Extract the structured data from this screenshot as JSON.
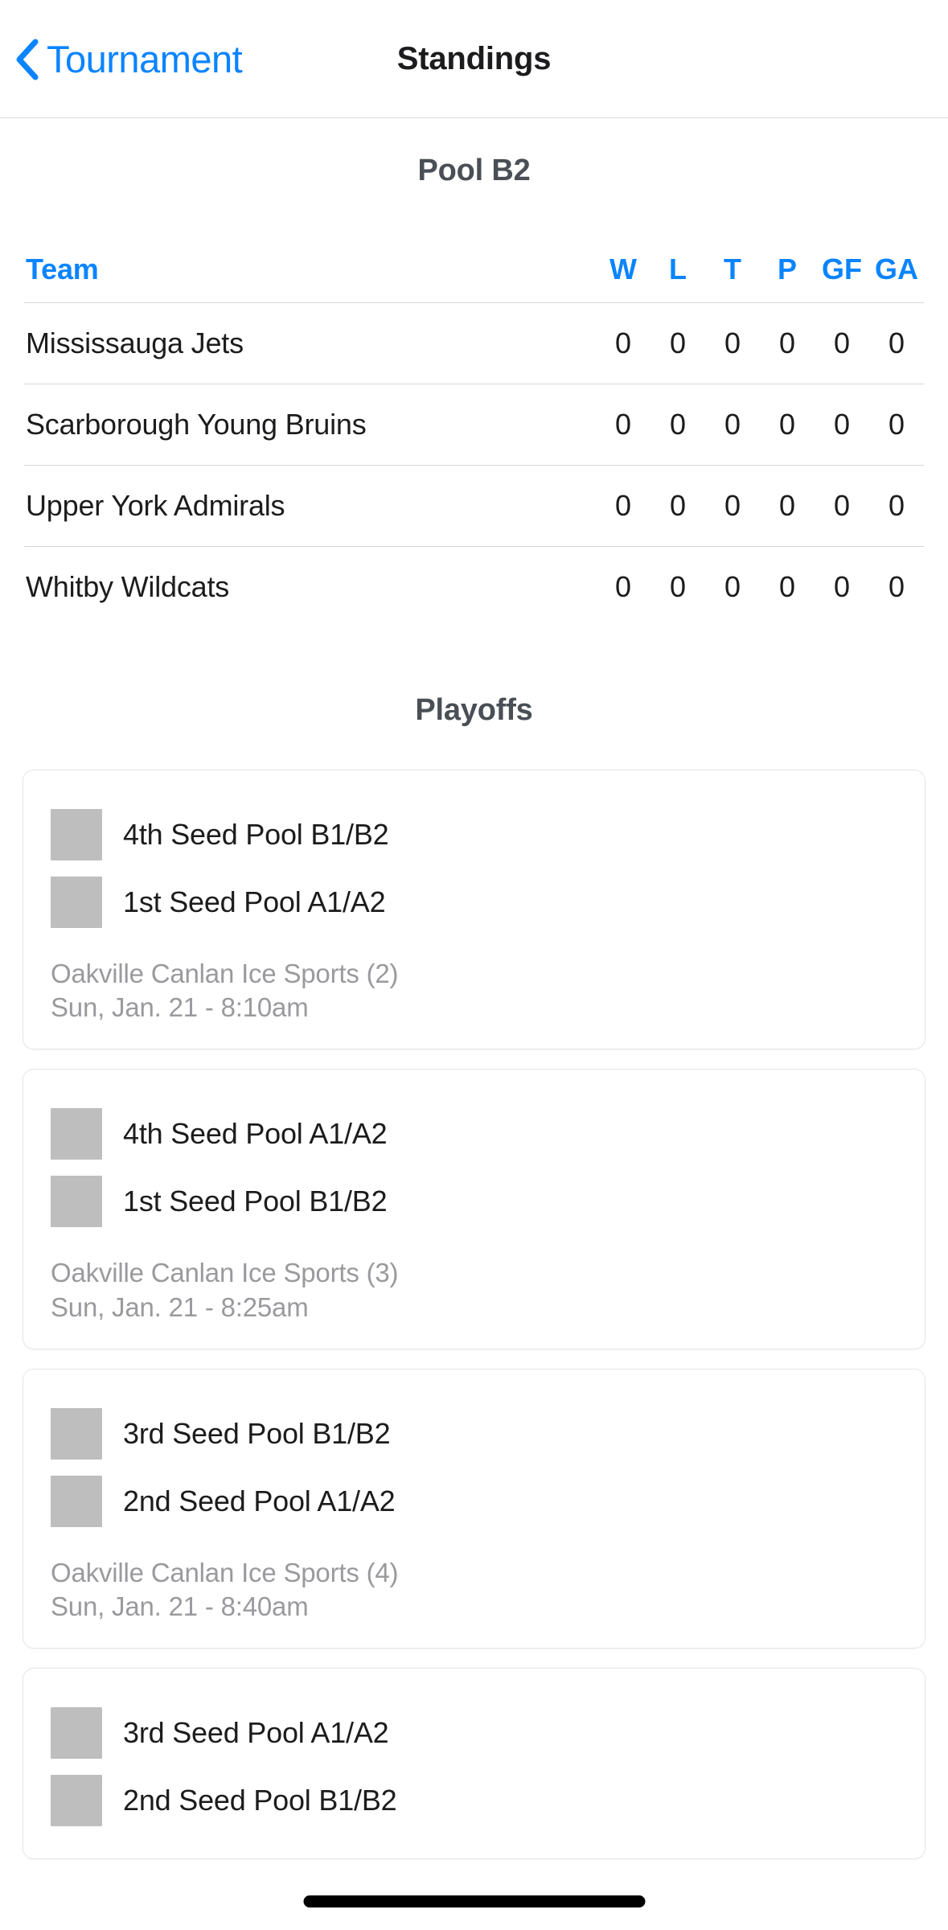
{
  "navbar": {
    "back_label": "Tournament",
    "back_icon": "chevron-left-icon",
    "title": "Standings"
  },
  "standings": {
    "pool_title": "Pool B2",
    "columns": [
      "Team",
      "W",
      "L",
      "T",
      "P",
      "GF",
      "GA"
    ],
    "rows": [
      {
        "team": "Mississauga Jets",
        "w": "0",
        "l": "0",
        "t": "0",
        "p": "0",
        "gf": "0",
        "ga": "0"
      },
      {
        "team": "Scarborough Young Bruins",
        "w": "0",
        "l": "0",
        "t": "0",
        "p": "0",
        "gf": "0",
        "ga": "0"
      },
      {
        "team": "Upper York Admirals",
        "w": "0",
        "l": "0",
        "t": "0",
        "p": "0",
        "gf": "0",
        "ga": "0"
      },
      {
        "team": "Whitby Wildcats",
        "w": "0",
        "l": "0",
        "t": "0",
        "p": "0",
        "gf": "0",
        "ga": "0"
      }
    ]
  },
  "playoffs": {
    "title": "Playoffs",
    "games": [
      {
        "away_team": "4th Seed Pool B1/B2",
        "home_team": "1st Seed Pool A1/A2",
        "venue": "Oakville Canlan Ice Sports (2)",
        "datetime": "Sun, Jan. 21 - 8:10am"
      },
      {
        "away_team": "4th Seed Pool A1/A2",
        "home_team": "1st Seed Pool B1/B2",
        "venue": "Oakville Canlan Ice Sports (3)",
        "datetime": "Sun, Jan. 21 - 8:25am"
      },
      {
        "away_team": "3rd Seed Pool B1/B2",
        "home_team": "2nd Seed Pool A1/A2",
        "venue": "Oakville Canlan Ice Sports (4)",
        "datetime": "Sun, Jan. 21 - 8:40am"
      },
      {
        "away_team": "3rd Seed Pool A1/A2",
        "home_team": "2nd Seed Pool B1/B2",
        "venue": "",
        "datetime": ""
      }
    ]
  },
  "colors": {
    "accent_blue": "#0a84ff",
    "heading_gray": "#4a4f55",
    "meta_gray": "#9a9a9e",
    "logo_placeholder": "#bebebe",
    "card_border": "#e4e6e9",
    "row_divider": "#d6d6d6"
  }
}
